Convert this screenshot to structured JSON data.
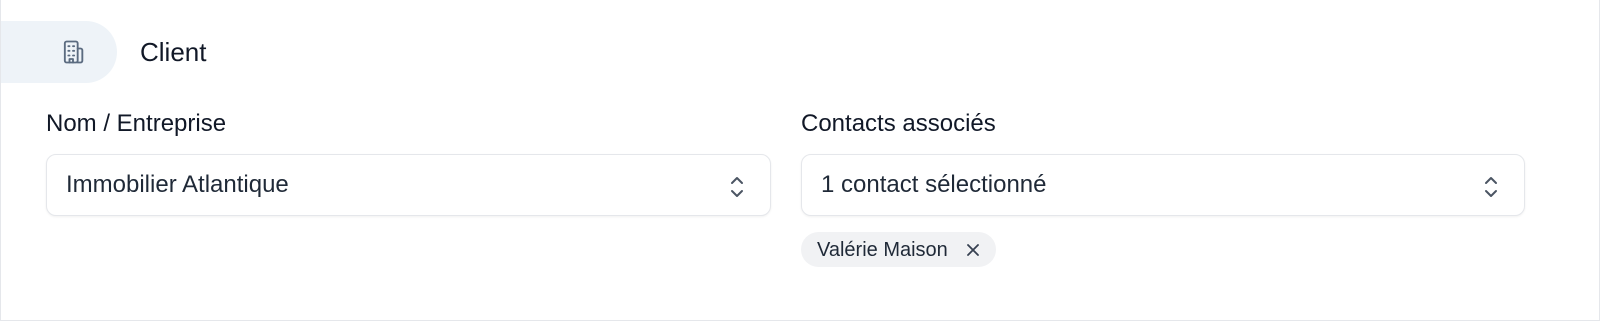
{
  "section": {
    "title": "Client",
    "icon": "building-icon"
  },
  "fields": {
    "company": {
      "label": "Nom / Entreprise",
      "value": "Immobilier Atlantique"
    },
    "contacts": {
      "label": "Contacts associés",
      "value": "1 contact sélectionné",
      "chips": [
        {
          "label": "Valérie Maison"
        }
      ]
    }
  },
  "colors": {
    "icon_pill_bg": "#eef3f8",
    "icon_stroke": "#5b6b80",
    "chip_bg": "#f1f2f4",
    "border": "#e5e7eb"
  }
}
